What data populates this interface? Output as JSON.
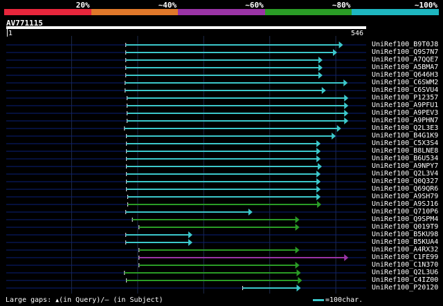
{
  "legend": {
    "labels": [
      "20%",
      "~40%",
      "~60%",
      "~80%",
      "~100%"
    ],
    "colors": [
      "#e8263c",
      "#e0782a",
      "#9a34a6",
      "#2a9c26",
      "#1eb6c0"
    ]
  },
  "query": {
    "name": "AV771115",
    "start": "1",
    "end": "546",
    "length": 546
  },
  "hits": [
    {
      "name": "UniRef100_B9T0J8",
      "start": 182,
      "end": 511,
      "color": "#3cc8cc"
    },
    {
      "name": "UniRef100_Q9S7N7",
      "start": 182,
      "end": 502,
      "color": "#3cc8cc"
    },
    {
      "name": "UniRef100_A7QQE7",
      "start": 182,
      "end": 480,
      "color": "#3cc8cc"
    },
    {
      "name": "UniRef100_A5BMA7",
      "start": 182,
      "end": 480,
      "color": "#3cc8cc"
    },
    {
      "name": "UniRef100_Q646H3",
      "start": 182,
      "end": 480,
      "color": "#3cc8cc"
    },
    {
      "name": "UniRef100_C6SWM2",
      "start": 181,
      "end": 518,
      "color": "#3cc8cc"
    },
    {
      "name": "UniRef100_C6SVU4",
      "start": 181,
      "end": 485,
      "color": "#3cc8cc"
    },
    {
      "name": "UniRef100_P12357",
      "start": 184,
      "end": 519,
      "color": "#3cc8cc"
    },
    {
      "name": "UniRef100_A9PFU1",
      "start": 184,
      "end": 519,
      "color": "#3cc8cc"
    },
    {
      "name": "UniRef100_A9PEV3",
      "start": 184,
      "end": 519,
      "color": "#3cc8cc"
    },
    {
      "name": "UniRef100_A9PHN7",
      "start": 184,
      "end": 519,
      "color": "#3cc8cc"
    },
    {
      "name": "UniRef100_Q2L3E3",
      "start": 180,
      "end": 508,
      "color": "#3cc8cc"
    },
    {
      "name": "UniRef100_B4G1K9",
      "start": 183,
      "end": 500,
      "color": "#3cc8cc"
    },
    {
      "name": "UniRef100_C5X3S4",
      "start": 183,
      "end": 477,
      "color": "#3cc8cc"
    },
    {
      "name": "UniRef100_B8LNE8",
      "start": 183,
      "end": 477,
      "color": "#3cc8cc"
    },
    {
      "name": "UniRef100_B6U534",
      "start": 183,
      "end": 477,
      "color": "#3cc8cc"
    },
    {
      "name": "UniRef100_A9NPY7",
      "start": 183,
      "end": 479,
      "color": "#3cc8cc"
    },
    {
      "name": "UniRef100_Q2L3V4",
      "start": 183,
      "end": 477,
      "color": "#3cc8cc"
    },
    {
      "name": "UniRef100_Q0Q327",
      "start": 183,
      "end": 477,
      "color": "#3cc8cc"
    },
    {
      "name": "UniRef100_Q69QR6",
      "start": 183,
      "end": 477,
      "color": "#3cc8cc"
    },
    {
      "name": "UniRef100_A9SH79",
      "start": 185,
      "end": 477,
      "color": "#3cc8cc"
    },
    {
      "name": "UniRef100_A9SJ16",
      "start": 185,
      "end": 478,
      "color": "#2a9c26"
    },
    {
      "name": "UniRef100_Q710P6",
      "start": 182,
      "end": 374,
      "color": "#3cc8cc"
    },
    {
      "name": "UniRef100_Q9SPM4",
      "start": 192,
      "end": 445,
      "color": "#2a9c26"
    },
    {
      "name": "UniRef100_Q019T9",
      "start": 202,
      "end": 445,
      "color": "#2a9c26"
    },
    {
      "name": "UniRef100_B5KU98",
      "start": 182,
      "end": 283,
      "color": "#3cc8cc"
    },
    {
      "name": "UniRef100_B5KUA4",
      "start": 182,
      "end": 283,
      "color": "#3cc8cc"
    },
    {
      "name": "UniRef100_A4RX32",
      "start": 202,
      "end": 445,
      "color": "#2a9c26"
    },
    {
      "name": "UniRef100_C1FE99",
      "start": 202,
      "end": 519,
      "color": "#9a34a6"
    },
    {
      "name": "UniRef100_C1N370",
      "start": 202,
      "end": 445,
      "color": "#2a9c26"
    },
    {
      "name": "UniRef100_Q2L3U6",
      "start": 180,
      "end": 447,
      "color": "#2a9c26"
    },
    {
      "name": "UniRef100_C4IZ00",
      "start": 183,
      "end": 449,
      "color": "#2a9c26"
    },
    {
      "name": "UniRef100_P20120",
      "start": 359,
      "end": 447,
      "color": "#3cc8cc"
    }
  ],
  "footer": {
    "gaps_prefix": "Large gaps:",
    "gaps_query_symbol": "▲",
    "gaps_text": "(in Query)/– (in Subject)",
    "scale_text": "=100char."
  }
}
